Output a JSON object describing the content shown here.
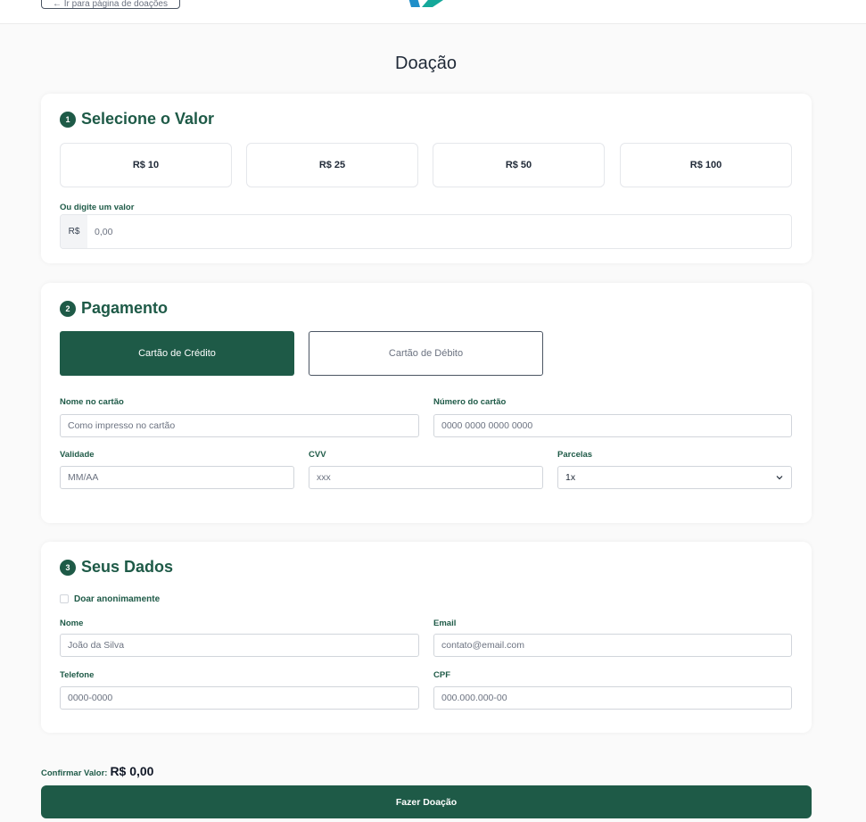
{
  "header": {
    "back_label": "← Ir para página de doações"
  },
  "page": {
    "title": "Doação"
  },
  "section_value": {
    "number": "1",
    "title": "Selecione o Valor",
    "amounts": [
      "R$ 10",
      "R$ 25",
      "R$ 50",
      "R$ 100"
    ],
    "custom_label": "Ou digite um valor",
    "currency_prefix": "R$",
    "custom_placeholder": "0,00"
  },
  "section_payment": {
    "number": "2",
    "title": "Pagamento",
    "methods": {
      "credit": "Cartão de Crédito",
      "debit": "Cartão de Débito",
      "selected": "credit"
    },
    "card_name": {
      "label": "Nome no cartão",
      "placeholder": "Como impresso no cartão"
    },
    "card_number": {
      "label": "Número do cartão",
      "placeholder": "0000 0000 0000 0000"
    },
    "expiry": {
      "label": "Validade",
      "placeholder": "MM/AA"
    },
    "cvv": {
      "label": "CVV",
      "placeholder": "xxx"
    },
    "installments": {
      "label": "Parcelas",
      "value": "1x"
    }
  },
  "section_data": {
    "number": "3",
    "title": "Seus Dados",
    "anonymous_label": "Doar anonimamente",
    "name": {
      "label": "Nome",
      "placeholder": "João da Silva"
    },
    "email": {
      "label": "Email",
      "placeholder": "contato@email.com"
    },
    "phone": {
      "label": "Telefone",
      "placeholder": "0000-0000"
    },
    "cpf": {
      "label": "CPF",
      "placeholder": "000.000.000-00"
    }
  },
  "footer": {
    "confirm_label": "Confirmar Valor:",
    "confirm_value": "R$ 0,00",
    "submit_label": "Fazer Doação"
  },
  "colors": {
    "brand": "#1e5a47",
    "logo_blue": "#1f8fc9",
    "logo_teal": "#14a89a"
  },
  "icons": {
    "logo": "brand-logo",
    "select": "chevron-down-icon"
  }
}
